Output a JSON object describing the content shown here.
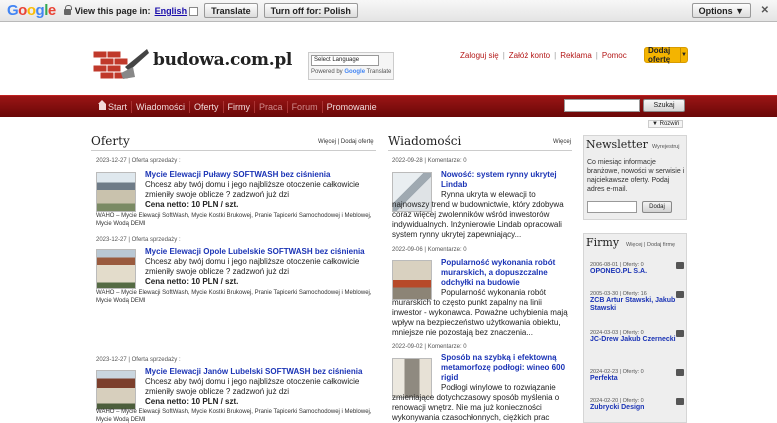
{
  "gbar": {
    "logo": [
      "G",
      "o",
      "o",
      "g",
      "l",
      "e"
    ],
    "view_text": "View this page in:",
    "language": "English",
    "translate_btn": "Translate",
    "turnoff_btn": "Turn off for: Polish",
    "options_btn": "Options ▼",
    "close": "✕"
  },
  "header": {
    "logo_text": "budowa.com.pl",
    "gt_select": "Select Language",
    "gt_powered_prefix": "Powered by",
    "gt_powered_brand": "Google",
    "gt_powered_suffix": "Translate",
    "links": [
      "Zaloguj się",
      "Załóż konto",
      "Reklama",
      "Pomoc"
    ],
    "offer_btn": "Dodaj ofertę",
    "offer_arrow": "▼"
  },
  "nav": {
    "items": [
      "Start",
      "Wiadomości",
      "Oferty",
      "Firmy",
      "Praca",
      "Forum",
      "Promowanie"
    ],
    "search_btn": "Szukaj",
    "expand": "▼ Rozwiń"
  },
  "offers": {
    "title": "Oferty",
    "links": "Więcej | Dodaj ofertę",
    "items": [
      {
        "date": "2023-12-27",
        "meta": "Oferta sprzedaży :",
        "title": "Mycie Elewacji Puławy SOFTWASH bez ciśnienia",
        "desc": "Chcesz aby twój domu i jego najbliższe otoczenie całkowicie zmieniły swoje oblicze ? zadzwoń już dzi",
        "price": "Cena netto: 10 PLN / szt.",
        "tags": "WAHO – Mycie Elewacji SoftWash, Mycie Kostki Brukowej, Pranie Tapicerki Samochodowej i Meblowej, Mycie Wodą DEMI"
      },
      {
        "date": "2023-12-27",
        "meta": "Oferta sprzedaży :",
        "title": "Mycie Elewacji Opole Lubelskie SOFTWASH bez ciśnienia",
        "desc": "Chcesz aby twój domu i jego najbliższe otoczenie całkowicie zmieniły swoje oblicze ? zadzwoń już dzi",
        "price": "Cena netto: 10 PLN / szt.",
        "tags": "WAHO – Mycie Elewacji SoftWash, Mycie Kostki Brukowej, Pranie Tapicerki Samochodowej i Meblowej, Mycie Wodą DEMI"
      },
      {
        "date": "2023-12-27",
        "meta": "Oferta sprzedaży :",
        "title": "Mycie Elewacji Janów Lubelski SOFTWASH bez ciśnienia",
        "desc": "Chcesz aby twój domu i jego najbliższe otoczenie całkowicie zmieniły swoje oblicze ? zadzwoń już dzi",
        "price": "Cena netto: 10 PLN / szt.",
        "tags": "WAHO – Mycie Elewacji SoftWash, Mycie Kostki Brukowej, Pranie Tapicerki Samochodowej i Meblowej, Mycie Wodą DEMI"
      }
    ]
  },
  "news": {
    "title": "Wiadomości",
    "links": "Więcej",
    "items": [
      {
        "date": "2022-09-28",
        "meta": "Komentarze: 0",
        "title": "Nowość: system rynny ukrytej Lindab",
        "desc": "Rynna ukryta w elewacji to najnowszy trend w budownictwie, który zdobywa coraz więcej zwolenników wśród inwestorów indywidualnych. Inżynierowie Lindab opracowali system rynny ukrytej zapewniający..."
      },
      {
        "date": "2022-09-06",
        "meta": "Komentarze: 0",
        "title": "Popularność wykonania robót murarskich, a dopuszczalne odchyłki na budowie",
        "desc": "Popularność wykonania robót murarskich to często punkt zapalny na linii inwestor - wykonawca. Poważne uchybienia mają wpływ na bezpieczeństwo użytkowania obiektu, mniejsze nie pozostają bez znaczenia..."
      },
      {
        "date": "2022-09-02",
        "meta": "Komentarze: 0",
        "title": "Sposób na szybką i efektowną metamorfozę podłogi: wineo 600 rigid",
        "desc": "Podłogi winylowe to rozwiązanie zmieniające dotychczasowy sposób myślenia o renowacji wnętrz. Nie ma już konieczności wykonywania czasochłonnych, ciężkich prac"
      }
    ]
  },
  "newsletter": {
    "title": "Newsletter",
    "sub": "Wyrejestruj",
    "text": "Co miesiąc informacje branżowe, nowości w serwisie i najciekawsze oferty. Podaj adres e-mail.",
    "btn": "Dodaj"
  },
  "firms": {
    "title": "Firmy",
    "links": "Więcej | Dodaj firmę",
    "items": [
      {
        "meta": "2006-08-01 | Oferty: 0",
        "name": "OPONEO.PL S.A."
      },
      {
        "meta": "2005-03-30 | Oferty: 16",
        "name": "ZCB Artur Stawski, Jakub Stawski"
      },
      {
        "meta": "2024-03-03 | Oferty: 0",
        "name": "JC-Drew Jakub Czernecki"
      },
      {
        "meta": "2024-02-23 | Oferty: 0",
        "name": "Perfekta"
      },
      {
        "meta": "2024-02-20 | Oferty: 0",
        "name": "Zubrycki Design"
      }
    ]
  },
  "colors": {
    "nav": "#8a1010",
    "link": "#1a33b5",
    "accent": "#f4b400",
    "toplink": "#b41818"
  }
}
